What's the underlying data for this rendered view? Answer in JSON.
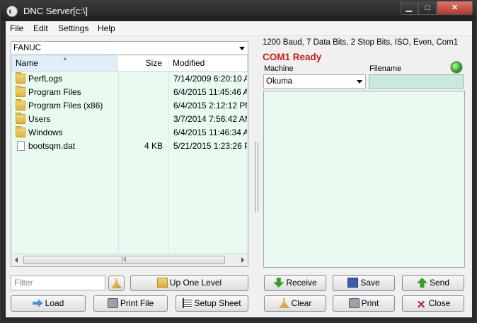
{
  "window": {
    "title": "DNC Server[c:\\]",
    "min_glyph": "▁",
    "max_glyph": "□",
    "close_glyph": "✕"
  },
  "menu": [
    "File",
    "Edit",
    "Settings",
    "Help"
  ],
  "left": {
    "dir_combo": "FANUC",
    "columns": {
      "name": "Name",
      "size": "Size",
      "modified": "Modified"
    },
    "sort_caret": "▲",
    "rows": [
      {
        "name": "PerfLogs",
        "size": "",
        "modified": "7/14/2009 6:20:10 A",
        "type": "folder"
      },
      {
        "name": "Program Files",
        "size": "",
        "modified": "6/4/2015 11:45:46 A",
        "type": "folder"
      },
      {
        "name": "Program Files (x86)",
        "size": "",
        "modified": "6/4/2015 2:12:12 PM",
        "type": "folder"
      },
      {
        "name": "Users",
        "size": "",
        "modified": "3/7/2014 7:56:42 AM",
        "type": "folder"
      },
      {
        "name": "Windows",
        "size": "",
        "modified": "6/4/2015 11:46:34 A",
        "type": "folder"
      },
      {
        "name": "bootsqm.dat",
        "size": "4 KB",
        "modified": "5/21/2015 1:23:26 PI",
        "type": "file"
      }
    ],
    "hscroll_grip": "III",
    "filter_placeholder": "Filter",
    "buttons": {
      "up_one_level": "Up One Level",
      "load": "Load",
      "print_file": "Print File",
      "setup_sheet": "Setup Sheet"
    }
  },
  "right": {
    "port_settings": "1200 Baud, 7 Data Bits, 2 Stop Bits, ISO, Even, Com1",
    "status": "COM1 Ready",
    "machine_label": "Machine",
    "machine_value": "Okuma",
    "filename_label": "Filename",
    "filename_value": "",
    "status_led_color": "#2da82a",
    "buttons": {
      "receive": "Receive",
      "save": "Save",
      "send": "Send",
      "clear": "Clear",
      "print": "Print",
      "close": "Close"
    }
  }
}
